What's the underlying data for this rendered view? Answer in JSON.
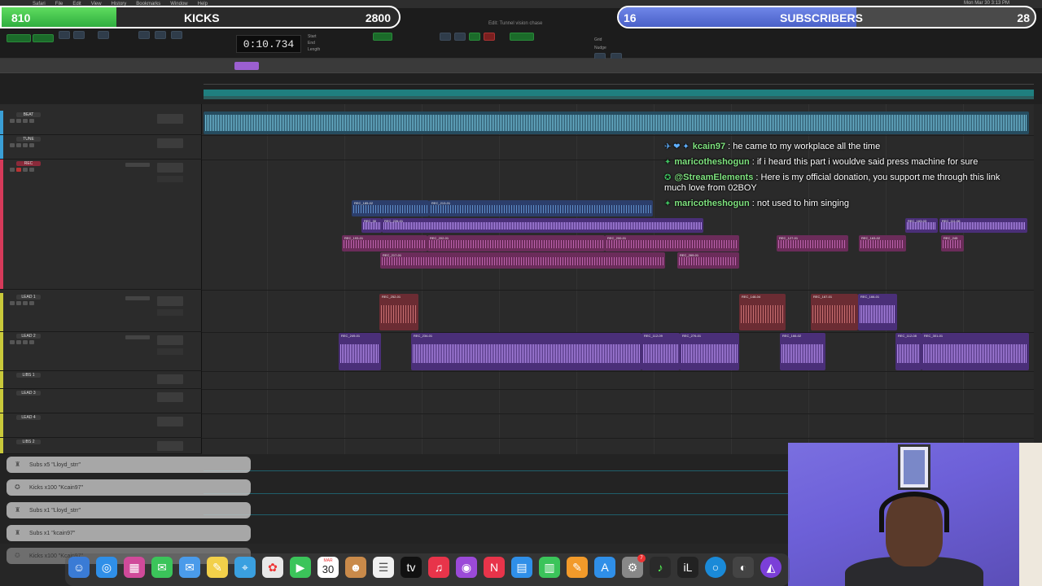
{
  "menubar": {
    "items": [
      "Safari",
      "File",
      "Edit",
      "View",
      "History",
      "Bookmarks",
      "Window",
      "Help"
    ],
    "clock": "Mon Mar 30  3:13 PM"
  },
  "daw": {
    "window_title": "Edit: Tunnel vision chase",
    "counter": "0:10.734",
    "counter_labels": [
      "Start",
      "End",
      "Length"
    ],
    "grid_label": "Grid",
    "nudge_label": "Nudge",
    "tracks": [
      {
        "name": "BEAT",
        "color": "#3a9fd6"
      },
      {
        "name": "TUNE",
        "color": "#3a9fd6"
      },
      {
        "name": "REC",
        "color": "#d63a5a"
      },
      {
        "name": "LEAD 1",
        "color": "#c9c93a"
      },
      {
        "name": "LEAD 2",
        "color": "#c9c93a"
      },
      {
        "name": "LIBS 1",
        "color": "#c9c93a"
      },
      {
        "name": "LEAD 3",
        "color": "#c9c93a"
      },
      {
        "name": "LEAD 4",
        "color": "#c9c93a"
      },
      {
        "name": "LIBS 2",
        "color": "#c9c93a"
      }
    ],
    "clips": {
      "rec_1": "REC_185-02",
      "rec_2": "REC_213-01",
      "rec_3": "REC_30",
      "rec_4": "REC_226-01",
      "rec_5": "REC_193-01",
      "rec_6": "REC_202-01",
      "rec_7": "REC_200-01",
      "rec_8": "REC_217-01",
      "rec_9": "REC_269-01",
      "rec_10": "REC_163-03",
      "rec_11": "REC_111-06",
      "rec_12": "REC_127-01",
      "rec_13": "REC_163-02",
      "rec_14": "REC_245",
      "lead1_1": "REC_252-01",
      "lead1_2": "REC_148-04",
      "lead1_3": "REC_167-01",
      "lead1_4": "REC_166-01",
      "lead2_1": "REC_249-01",
      "lead2_2": "REC_234-01",
      "lead2_3": "REC_112-09",
      "lead2_4": "REC_276-01",
      "lead2_5": "REC_166-02",
      "lead2_6": "REC_112-08",
      "lead2_7": "REC_301-01"
    }
  },
  "overlay": {
    "kicks": {
      "current": "810",
      "label": "KICKS",
      "goal": "2800",
      "progress": 0.289
    },
    "subs": {
      "current": "16",
      "label": "SUBSCRIBERS",
      "goal": "28",
      "progress": 0.571
    },
    "chat": [
      {
        "user": "kcain97",
        "text": " : he came to my workplace all the time",
        "badges": "✈ ❤ ✦"
      },
      {
        "user": "maricotheshogun",
        "text": " : if i heard this part i wouldve said press machine for sure",
        "badges": "✦"
      },
      {
        "user": "@StreamElements",
        "text": " : Here is my official donation, you support me through this link much love from 02BOY",
        "badges": "✪"
      },
      {
        "user": "maricotheshogun",
        "text": " : not used to him singing",
        "badges": "✦"
      }
    ],
    "alerts": [
      "Subs x5 \"Lloyd_strr\"",
      "Kicks x100 \"Kcain97\"",
      "Subs x1 \"Lloyd_strr\"",
      "Subs x1 \"kcain97\"",
      "Kicks x100 \"Kcain97\""
    ]
  },
  "dock": {
    "calendar_month": "MAR",
    "calendar_day": "30",
    "badge": "7"
  }
}
